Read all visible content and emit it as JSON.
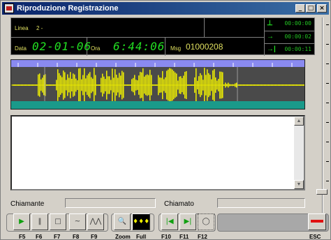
{
  "window": {
    "title": "Riproduzione Registrazione",
    "controls": [
      "_",
      "□",
      "×"
    ]
  },
  "info": {
    "linea_label": "Linea",
    "linea_value": "2 -",
    "data_label": "Data",
    "data_value": "02-01-06",
    "ora_label": "Ora",
    "ora_value": "6:44:06",
    "msg_label": "Msg",
    "msg_value": "01000208",
    "timers": [
      {
        "icon": "download-icon",
        "value": "00:00:00"
      },
      {
        "icon": "arrow-right-icon",
        "value": "00:00:02"
      },
      {
        "icon": "arrow-end-icon",
        "value": "00:00:11"
      }
    ]
  },
  "fields": {
    "chiamante_label": "Chiamante",
    "chiamante_value": "",
    "chiamato_label": "Chiamato",
    "chiamato_value": ""
  },
  "toolbar": {
    "buttons": [
      {
        "name": "play-button",
        "icon": "play-icon",
        "key": "F5"
      },
      {
        "name": "pause-button",
        "icon": "pause-icon",
        "key": "F6"
      },
      {
        "name": "stop-button",
        "icon": "stop-icon",
        "key": "F7"
      },
      {
        "name": "f8-button",
        "icon": "wave-icon",
        "key": "F8"
      },
      {
        "name": "f9-button",
        "icon": "wave-icon",
        "key": "F9"
      },
      {
        "name": "zoom-button",
        "icon": "magnifier-icon",
        "key": "Zoom"
      },
      {
        "name": "full-button",
        "icon": "waveform-icon",
        "key": "Full"
      },
      {
        "name": "go-start-button",
        "icon": "skip-start-icon",
        "key": "F10"
      },
      {
        "name": "go-end-button",
        "icon": "skip-end-icon",
        "key": "F11"
      },
      {
        "name": "f12-button",
        "icon": "stopwatch-icon",
        "key": "F12"
      },
      {
        "name": "esc-button",
        "icon": "minus-icon",
        "key": "ESC"
      }
    ]
  },
  "colors": {
    "waveform": "#f0f000",
    "display_text": "#22e022",
    "label_text": "#e0e060",
    "ruler": "#8a8af0",
    "baseband": "#1a9a8a"
  }
}
